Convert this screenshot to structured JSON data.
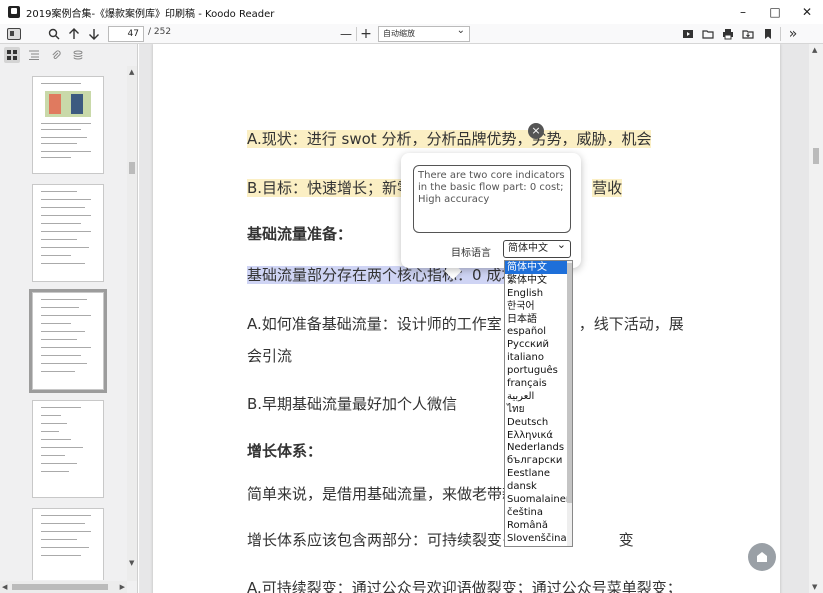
{
  "window": {
    "title": "2019案例合集-《爆款案例库》印刷稿 - Koodo Reader",
    "controls": [
      "–",
      "□",
      "✕"
    ]
  },
  "toolbar": {
    "current_page": "47",
    "total_pages": "/ 252",
    "zoom_minus": "—",
    "zoom_plus": "+",
    "zoom_value": "自动缩放",
    "more": "»"
  },
  "document": {
    "lines": [
      {
        "text": "A.现状：进行 swot 分析，分析品牌优势，劣势，威胁，机会"
      },
      {
        "text": "B.目标：快速增长；新零",
        "text_tail": "营收"
      },
      {
        "text": "基础流量准备："
      },
      {
        "text": "基础流量部分存在两个核心指标：0 成本 高"
      },
      {
        "text": "A.如何准备基础流量：设计师的工作室，",
        "text_tail": "，线下活动，展"
      },
      {
        "text": "会引流"
      },
      {
        "text": "B.早期基础流量最好加个人微信"
      },
      {
        "text": "增长体系："
      },
      {
        "text": "简单来说，是借用基础流量，来做老带新"
      },
      {
        "text": "增长体系应该包含两部分：可持续裂变+",
        "text_tail": "变"
      },
      {
        "text": "A.可持续裂变：通过公众号欢迎语做裂变；通过公众号菜单裂变；"
      }
    ]
  },
  "translation_popup": {
    "translated_text": "There are two core indicators in the basic flow part: 0 cost; High accuracy",
    "target_language_label": "目标语言",
    "selected_language": "简体中文",
    "close_icon": "×"
  },
  "language_options": [
    "简体中文",
    "繁体中文",
    "English",
    "한국어",
    "日本語",
    "español",
    "Русский",
    "italiano",
    "português",
    "français",
    "العربية",
    "ไทย",
    "Deutsch",
    "Ελληνικά",
    "Nederlands",
    "български",
    "Eestlane",
    "dansk",
    "Suomalainen",
    "čeština",
    "Română",
    "Slovenščina"
  ],
  "colors": {
    "highlight_yellow": "#fbefc4",
    "highlight_blue": "#cfd4f4",
    "selected_option": "#1e6fd9"
  }
}
